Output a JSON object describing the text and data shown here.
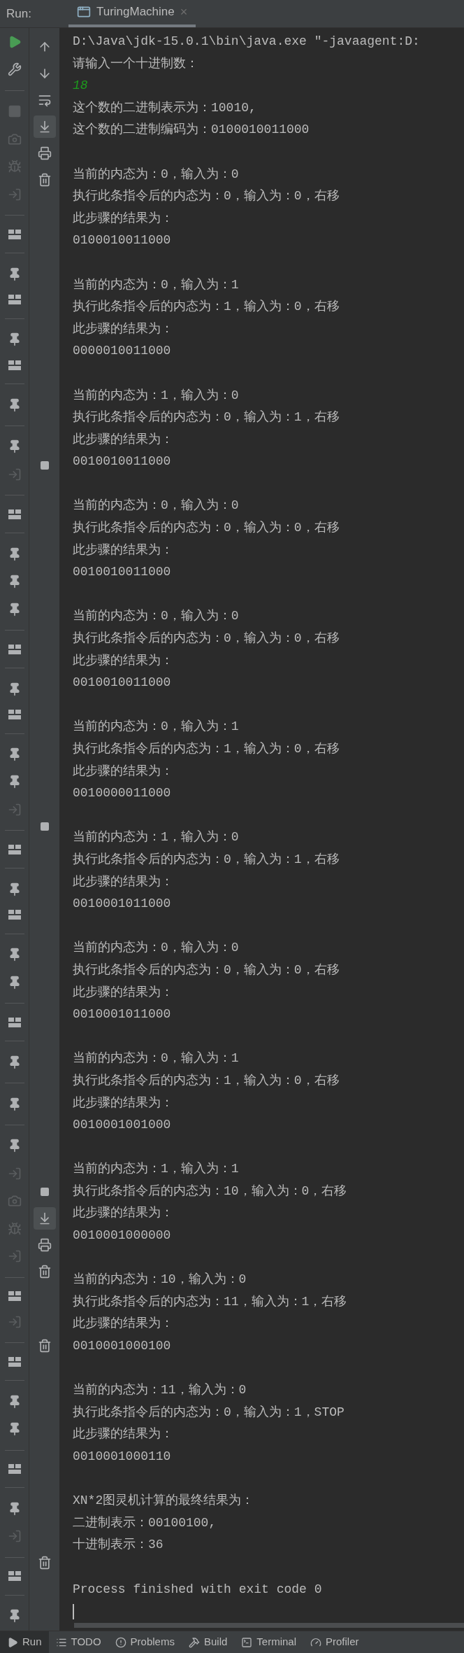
{
  "header": {
    "run_label": "Run:",
    "tab": {
      "label": "TuringMachine",
      "selected": true,
      "close": "×"
    }
  },
  "left_toolbar": [
    {
      "kind": "run"
    },
    {
      "kind": "wrench"
    },
    {
      "kind": "separator"
    },
    {
      "kind": "stop"
    },
    {
      "kind": "camera"
    },
    {
      "kind": "bug"
    },
    {
      "kind": "exit"
    },
    {
      "kind": "separator"
    },
    {
      "kind": "layout"
    },
    {
      "kind": "separator"
    },
    {
      "kind": "pin"
    },
    {
      "kind": "layout"
    },
    {
      "kind": "separator"
    },
    {
      "kind": "pin"
    },
    {
      "kind": "layout"
    },
    {
      "kind": "separator"
    },
    {
      "kind": "pin"
    },
    {
      "kind": "separator"
    },
    {
      "kind": "pin"
    },
    {
      "kind": "exit"
    },
    {
      "kind": "separator"
    },
    {
      "kind": "layout"
    },
    {
      "kind": "separator"
    },
    {
      "kind": "pin"
    },
    {
      "kind": "pin"
    },
    {
      "kind": "pin"
    },
    {
      "kind": "separator"
    },
    {
      "kind": "layout"
    },
    {
      "kind": "separator"
    },
    {
      "kind": "pin"
    },
    {
      "kind": "layout"
    },
    {
      "kind": "separator"
    },
    {
      "kind": "pin"
    },
    {
      "kind": "pin"
    },
    {
      "kind": "exit"
    },
    {
      "kind": "separator"
    },
    {
      "kind": "layout"
    },
    {
      "kind": "separator"
    },
    {
      "kind": "pin"
    },
    {
      "kind": "layout"
    },
    {
      "kind": "separator"
    },
    {
      "kind": "pin"
    },
    {
      "kind": "pin"
    },
    {
      "kind": "separator"
    },
    {
      "kind": "layout"
    },
    {
      "kind": "separator"
    },
    {
      "kind": "pin"
    },
    {
      "kind": "separator"
    },
    {
      "kind": "pin"
    },
    {
      "kind": "separator"
    },
    {
      "kind": "pin"
    },
    {
      "kind": "exit"
    },
    {
      "kind": "camera"
    },
    {
      "kind": "bug"
    },
    {
      "kind": "exit"
    },
    {
      "kind": "separator"
    },
    {
      "kind": "layout"
    },
    {
      "kind": "exit"
    },
    {
      "kind": "separator"
    },
    {
      "kind": "layout"
    },
    {
      "kind": "separator"
    },
    {
      "kind": "pin"
    },
    {
      "kind": "pin"
    },
    {
      "kind": "separator"
    },
    {
      "kind": "layout"
    },
    {
      "kind": "separator"
    },
    {
      "kind": "pin"
    },
    {
      "kind": "exit"
    },
    {
      "kind": "separator"
    },
    {
      "kind": "layout"
    },
    {
      "kind": "separator"
    },
    {
      "kind": "pin"
    }
  ],
  "side_toolbar": [
    [
      {
        "kind": "up",
        "selected": false
      },
      {
        "kind": "down",
        "selected": false
      },
      {
        "kind": "wrap",
        "selected": false
      },
      {
        "kind": "scroll",
        "selected": true
      },
      {
        "kind": "print",
        "selected": false
      },
      {
        "kind": "trash",
        "selected": false
      }
    ],
    [
      {
        "kind": "square",
        "selected": false
      }
    ],
    [
      {
        "kind": "square",
        "selected": false
      }
    ],
    [
      {
        "kind": "square",
        "selected": false
      },
      {
        "kind": "scroll",
        "selected": true
      },
      {
        "kind": "print",
        "selected": false
      },
      {
        "kind": "trash",
        "selected": false
      }
    ],
    [
      {
        "kind": "trash",
        "selected": false
      }
    ],
    [
      {
        "kind": "trash",
        "selected": false
      }
    ]
  ],
  "console": {
    "lines": [
      {
        "kind": "text",
        "text": "D:\\Java\\jdk-15.0.1\\bin\\java.exe \"-javaagent:D:"
      },
      {
        "kind": "text",
        "text": "请输入一个十进制数："
      },
      {
        "kind": "input",
        "text": "18"
      },
      {
        "kind": "text",
        "text": "这个数的二进制表示为：10010,"
      },
      {
        "kind": "text",
        "text": "这个数的二进制编码为：0100010011000"
      },
      {
        "kind": "blank"
      },
      {
        "kind": "text",
        "text": "当前的内态为：0，输入为：0"
      },
      {
        "kind": "text",
        "text": "执行此条指令后的内态为：0，输入为：0，右移"
      },
      {
        "kind": "text",
        "text": "此步骤的结果为："
      },
      {
        "kind": "text",
        "text": "0100010011000"
      },
      {
        "kind": "blank"
      },
      {
        "kind": "text",
        "text": "当前的内态为：0，输入为：1"
      },
      {
        "kind": "text",
        "text": "执行此条指令后的内态为：1，输入为：0，右移"
      },
      {
        "kind": "text",
        "text": "此步骤的结果为："
      },
      {
        "kind": "text",
        "text": "0000010011000"
      },
      {
        "kind": "blank"
      },
      {
        "kind": "text",
        "text": "当前的内态为：1，输入为：0"
      },
      {
        "kind": "text",
        "text": "执行此条指令后的内态为：0，输入为：1，右移"
      },
      {
        "kind": "text",
        "text": "此步骤的结果为："
      },
      {
        "kind": "text",
        "text": "0010010011000"
      },
      {
        "kind": "blank"
      },
      {
        "kind": "text",
        "text": "当前的内态为：0，输入为：0"
      },
      {
        "kind": "text",
        "text": "执行此条指令后的内态为：0，输入为：0，右移"
      },
      {
        "kind": "text",
        "text": "此步骤的结果为："
      },
      {
        "kind": "text",
        "text": "0010010011000"
      },
      {
        "kind": "blank"
      },
      {
        "kind": "text",
        "text": "当前的内态为：0，输入为：0"
      },
      {
        "kind": "text",
        "text": "执行此条指令后的内态为：0，输入为：0，右移"
      },
      {
        "kind": "text",
        "text": "此步骤的结果为："
      },
      {
        "kind": "text",
        "text": "0010010011000"
      },
      {
        "kind": "blank"
      },
      {
        "kind": "text",
        "text": "当前的内态为：0，输入为：1"
      },
      {
        "kind": "text",
        "text": "执行此条指令后的内态为：1，输入为：0，右移"
      },
      {
        "kind": "text",
        "text": "此步骤的结果为："
      },
      {
        "kind": "text",
        "text": "0010000011000"
      },
      {
        "kind": "blank"
      },
      {
        "kind": "text",
        "text": "当前的内态为：1，输入为：0"
      },
      {
        "kind": "text",
        "text": "执行此条指令后的内态为：0，输入为：1，右移"
      },
      {
        "kind": "text",
        "text": "此步骤的结果为："
      },
      {
        "kind": "text",
        "text": "0010001011000"
      },
      {
        "kind": "blank"
      },
      {
        "kind": "text",
        "text": "当前的内态为：0，输入为：0"
      },
      {
        "kind": "text",
        "text": "执行此条指令后的内态为：0，输入为：0，右移"
      },
      {
        "kind": "text",
        "text": "此步骤的结果为："
      },
      {
        "kind": "text",
        "text": "0010001011000"
      },
      {
        "kind": "blank"
      },
      {
        "kind": "text",
        "text": "当前的内态为：0，输入为：1"
      },
      {
        "kind": "text",
        "text": "执行此条指令后的内态为：1，输入为：0，右移"
      },
      {
        "kind": "text",
        "text": "此步骤的结果为："
      },
      {
        "kind": "text",
        "text": "0010001001000"
      },
      {
        "kind": "blank"
      },
      {
        "kind": "text",
        "text": "当前的内态为：1，输入为：1"
      },
      {
        "kind": "text",
        "text": "执行此条指令后的内态为：10，输入为：0，右移"
      },
      {
        "kind": "text",
        "text": "此步骤的结果为："
      },
      {
        "kind": "text",
        "text": "0010001000000"
      },
      {
        "kind": "blank"
      },
      {
        "kind": "text",
        "text": "当前的内态为：10，输入为：0"
      },
      {
        "kind": "text",
        "text": "执行此条指令后的内态为：11，输入为：1，右移"
      },
      {
        "kind": "text",
        "text": "此步骤的结果为："
      },
      {
        "kind": "text",
        "text": "0010001000100"
      },
      {
        "kind": "blank"
      },
      {
        "kind": "text",
        "text": "当前的内态为：11，输入为：0"
      },
      {
        "kind": "text",
        "text": "执行此条指令后的内态为：0，输入为：1，STOP"
      },
      {
        "kind": "text",
        "text": "此步骤的结果为："
      },
      {
        "kind": "text",
        "text": "0010001000110"
      },
      {
        "kind": "blank"
      },
      {
        "kind": "text",
        "text": "XN*2图灵机计算的最终结果为："
      },
      {
        "kind": "text",
        "text": "二进制表示：00100100,"
      },
      {
        "kind": "text",
        "text": "十进制表示：36"
      },
      {
        "kind": "blank"
      },
      {
        "kind": "text",
        "text": "Process finished with exit code 0"
      },
      {
        "kind": "cursor"
      }
    ]
  },
  "bottom_tabs": [
    {
      "label": "Run",
      "selected": true
    },
    {
      "label": "TODO",
      "selected": false
    },
    {
      "label": "Problems",
      "selected": false
    },
    {
      "label": "Build",
      "selected": false
    },
    {
      "label": "Terminal",
      "selected": false
    },
    {
      "label": "Profiler",
      "selected": false
    }
  ]
}
